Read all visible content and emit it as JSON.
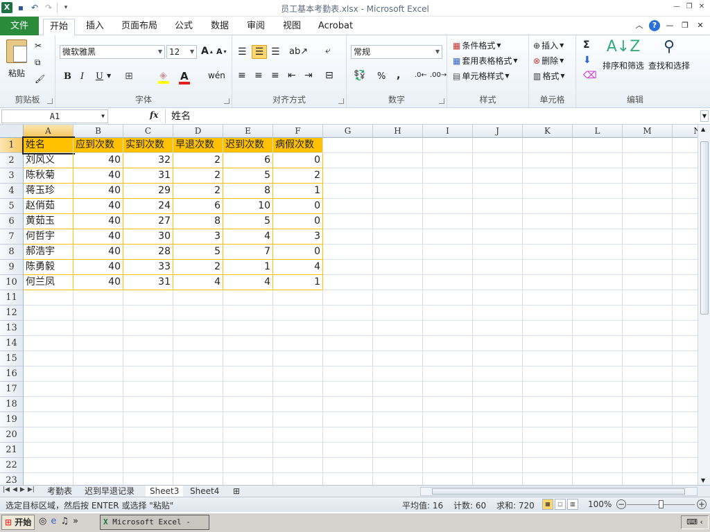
{
  "window": {
    "title": "员工基本考勤表.xlsx - Microsoft Excel"
  },
  "tabs": [
    {
      "label": "文件"
    },
    {
      "label": "开始"
    },
    {
      "label": "插入"
    },
    {
      "label": "页面布局"
    },
    {
      "label": "公式"
    },
    {
      "label": "数据"
    },
    {
      "label": "审阅"
    },
    {
      "label": "视图"
    },
    {
      "label": "Acrobat"
    }
  ],
  "ribbon": {
    "clipboard": {
      "label": "剪贴板",
      "paste": "粘贴"
    },
    "font": {
      "label": "字体",
      "name": "微软雅黑",
      "size": "12",
      "bold": "B",
      "italic": "I",
      "underline": "U",
      "fontcolor": "A"
    },
    "alignment": {
      "label": "对齐方式"
    },
    "number": {
      "label": "数字",
      "format": "常规",
      "percent": "%",
      "comma": ","
    },
    "styles": {
      "label": "样式",
      "conditional": "条件格式",
      "table": "套用表格格式",
      "cell": "单元格样式"
    },
    "cells": {
      "label": "单元格",
      "insert": "插入",
      "delete": "删除",
      "format": "格式"
    },
    "editing": {
      "label": "编辑",
      "sum": "Σ",
      "sort": "排序和筛选",
      "find": "查找和选择"
    }
  },
  "formula_bar": {
    "name_box": "A1",
    "fx": "fx",
    "content": "姓名"
  },
  "columns": [
    "A",
    "B",
    "C",
    "D",
    "E",
    "F",
    "G",
    "H",
    "I",
    "J",
    "K",
    "L",
    "M",
    "N"
  ],
  "rows": [
    "1",
    "2",
    "3",
    "4",
    "5",
    "6",
    "7",
    "8",
    "9",
    "10",
    "11",
    "12",
    "13",
    "14",
    "15",
    "16",
    "17",
    "18",
    "19",
    "20",
    "21",
    "22",
    "23"
  ],
  "table": {
    "headers": [
      "姓名",
      "应到次数",
      "实到次数",
      "早退次数",
      "迟到次数",
      "病假次数"
    ],
    "data": [
      [
        "刘风义",
        "40",
        "32",
        "2",
        "6",
        "0"
      ],
      [
        "陈秋菊",
        "40",
        "31",
        "2",
        "5",
        "2"
      ],
      [
        "蒋玉珍",
        "40",
        "29",
        "2",
        "8",
        "1"
      ],
      [
        "赵俏茹",
        "40",
        "24",
        "6",
        "10",
        "0"
      ],
      [
        "黄茹玉",
        "40",
        "27",
        "8",
        "5",
        "0"
      ],
      [
        "何哲宇",
        "40",
        "30",
        "3",
        "4",
        "3"
      ],
      [
        "郝浩宇",
        "40",
        "28",
        "5",
        "7",
        "0"
      ],
      [
        "陈勇毅",
        "40",
        "33",
        "2",
        "1",
        "4"
      ],
      [
        "何兰凤",
        "40",
        "31",
        "4",
        "4",
        "1"
      ]
    ]
  },
  "sheets": [
    {
      "label": "考勤表"
    },
    {
      "label": "迟到早退记录"
    },
    {
      "label": "Sheet3"
    },
    {
      "label": "Sheet4"
    }
  ],
  "status": {
    "message": "选定目标区域，然后按 ENTER 或选择 \"粘贴\"",
    "average": "平均值: 16",
    "count": "计数: 60",
    "sum": "求和: 720",
    "zoom": "100%"
  },
  "taskbar": {
    "start": "开始",
    "task": "Microsoft Excel - ..."
  },
  "colors": {
    "header_fill": "#ffc000",
    "file_tab": "#2a8b3b"
  }
}
